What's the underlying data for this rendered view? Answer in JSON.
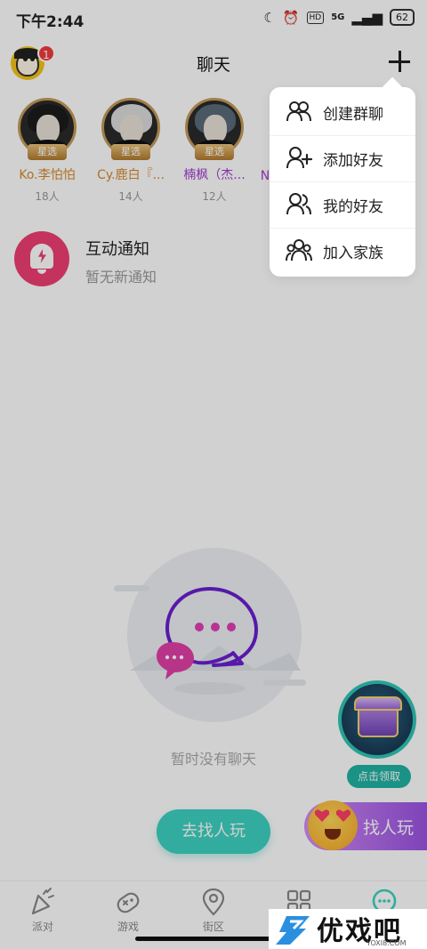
{
  "status_bar": {
    "time": "下午2:44",
    "hd": "HD",
    "network": "5G",
    "battery": "62"
  },
  "header": {
    "title": "聊天",
    "notification_count": "1"
  },
  "stars": [
    {
      "tag": "星选",
      "name": "Ko.李怕怕",
      "count": "18人",
      "hair_color": "#1b1b1b"
    },
    {
      "tag": "星选",
      "name": "Cy.鹿白『...",
      "count": "14人",
      "hair_color": "#dcdcdc"
    },
    {
      "tag": "星选",
      "name": "楠枫（杰...",
      "count": "12人",
      "hair_color": "#5a6b78"
    },
    {
      "tag": "",
      "name": "N",
      "count": "",
      "hair_color": "#333333"
    }
  ],
  "interaction": {
    "title": "互动通知",
    "subtitle": "暂无新通知"
  },
  "empty_state": {
    "text": "暂时没有聊天"
  },
  "find_button": {
    "label": "去找人玩"
  },
  "chest": {
    "claim_label": "点击领取"
  },
  "play_widget": {
    "label": "找人玩"
  },
  "menu": {
    "items": [
      {
        "label": "创建群聊",
        "icon": "group-icon"
      },
      {
        "label": "添加好友",
        "icon": "add-friend-icon"
      },
      {
        "label": "我的好友",
        "icon": "friends-icon"
      },
      {
        "label": "加入家族",
        "icon": "family-icon"
      }
    ]
  },
  "tabbar": {
    "items": [
      {
        "label": "派对",
        "icon": "party-icon"
      },
      {
        "label": "游戏",
        "icon": "game-icon"
      },
      {
        "label": "街区",
        "icon": "location-icon"
      },
      {
        "label": "",
        "icon": "grid-icon"
      },
      {
        "label": "",
        "icon": "chat-icon"
      }
    ]
  },
  "watermark": {
    "brand": "优戏吧",
    "url": "YOXI8.COM"
  },
  "colors": {
    "accent_teal": "#3cd2c1",
    "notice_pink": "#ee3f73",
    "star_gold": "#c59a5a",
    "play_purple": "#9a53e2",
    "overlay": "rgba(0,0,0,0.18)"
  }
}
